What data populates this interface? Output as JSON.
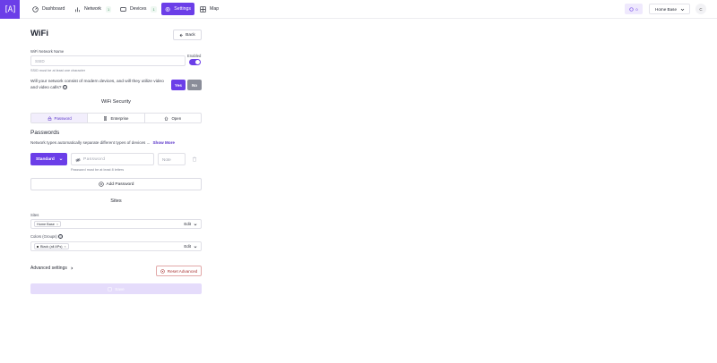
{
  "nav": {
    "logo_text": "[A]",
    "items": [
      {
        "label": "Dashboard",
        "icon": "dashboard-icon"
      },
      {
        "label": "Network",
        "badge": "1",
        "icon": "network-icon"
      },
      {
        "label": "Devices",
        "badge": "1",
        "icon": "devices-icon"
      },
      {
        "label": "Settings",
        "icon": "gear-icon",
        "active": true
      },
      {
        "label": "Map",
        "icon": "map-icon"
      }
    ],
    "notification_count": "0",
    "site_select": "Home Base",
    "avatar_initial": "C"
  },
  "page": {
    "title": "WiFi",
    "back_label": "Back"
  },
  "form": {
    "network_name_label": "WiFi Network Name",
    "ssid_placeholder": "SSID",
    "ssid_hint": "SSID must be at least one character",
    "enabled_label": "Enabled",
    "modern_question": "Will your network consist of modern devices, and will they utilize video and video calls?",
    "yes_label": "Yes",
    "no_label": "No",
    "security_title": "WiFi Security",
    "security_options": [
      "Password",
      "Enterprise",
      "Open"
    ],
    "passwords_title": "Passwords",
    "passwords_desc": "Network types automatically separate different types of devices ...",
    "show_more": "Show More",
    "type_label": "Standard",
    "password_placeholder": "Password",
    "note_placeholder": "Note",
    "password_hint": "Password must be at least 8 letters",
    "add_password_label": "Add Password",
    "sites_title": "Sites",
    "sites_label": "Sites",
    "sites_chip": "Home Base",
    "colors_label": "Colors (Groups)",
    "colors_chip": "Black (all APs)",
    "edit_label": "Edit",
    "advanced_label": "Advanced settings",
    "reset_label": "Reset Advanced",
    "save_label": "Save"
  },
  "colors": {
    "accent": "#6b3ee8",
    "danger": "#a83232"
  }
}
